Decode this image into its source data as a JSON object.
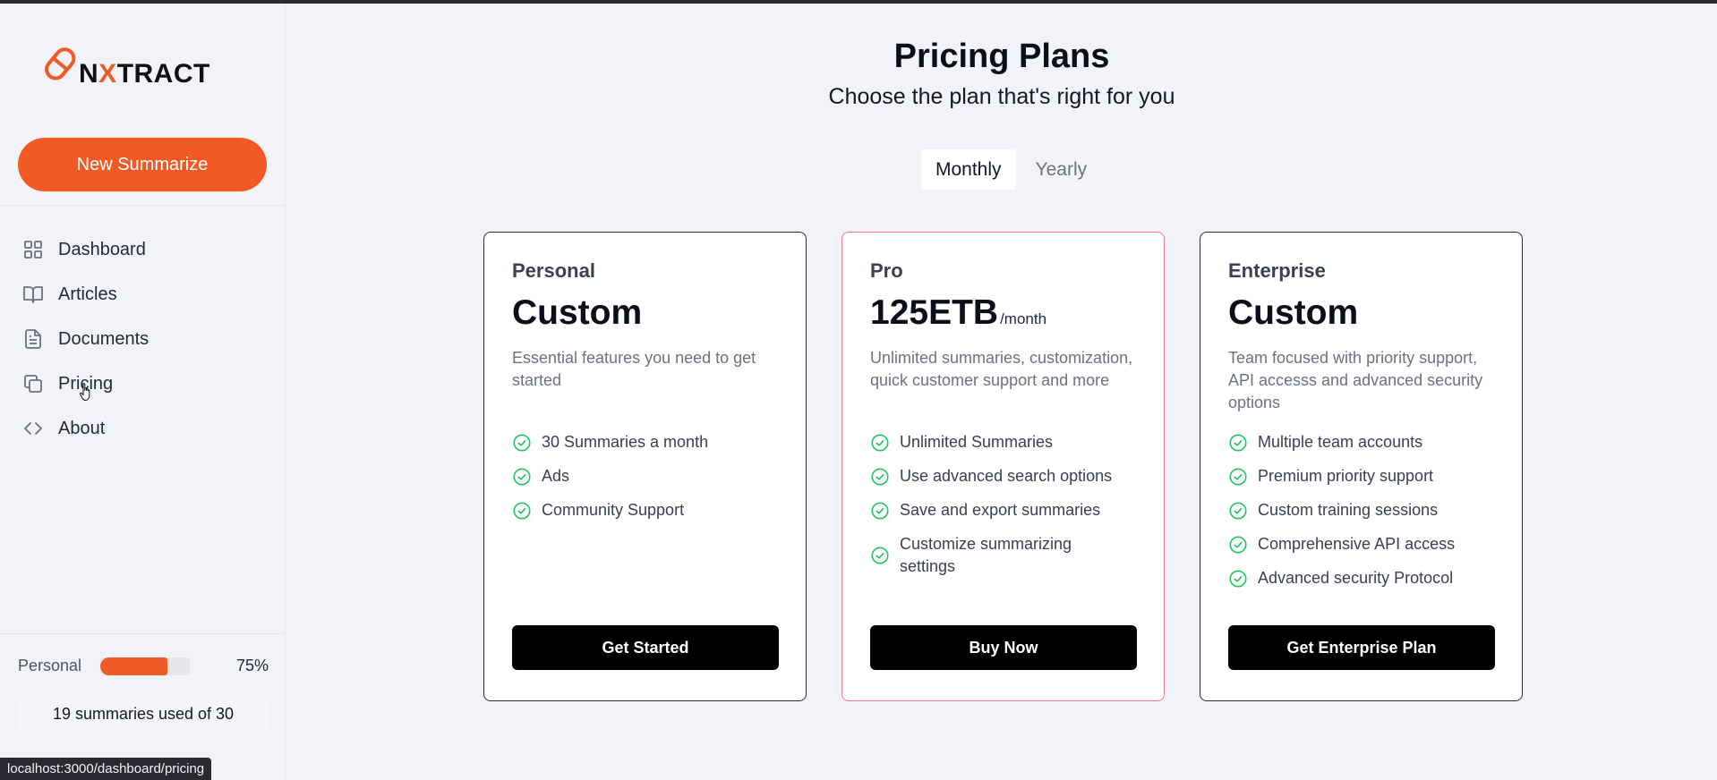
{
  "brand": {
    "logo_text_prefix": "N",
    "logo_text_x": "X",
    "logo_text_suffix": "TRACT",
    "accent": "#f15a24"
  },
  "sidebar": {
    "new_button_label": "New Summarize",
    "items": [
      {
        "label": "Dashboard",
        "icon": "grid-icon"
      },
      {
        "label": "Articles",
        "icon": "book-open-icon"
      },
      {
        "label": "Documents",
        "icon": "document-icon"
      },
      {
        "label": "Pricing",
        "icon": "copy-icon"
      },
      {
        "label": "About",
        "icon": "code-icon"
      }
    ],
    "plan": {
      "name": "Personal",
      "percent_label": "75%",
      "progress": 0.75
    },
    "usage_text": "19 summaries used of 30"
  },
  "status_url": "localhost:3000/dashboard/pricing",
  "main": {
    "title": "Pricing Plans",
    "subtitle": "Choose the plan that's right for you",
    "billing_toggle": {
      "options": [
        "Monthly",
        "Yearly"
      ],
      "selected": "Monthly"
    },
    "plans": [
      {
        "name": "Personal",
        "price": "Custom",
        "period": "",
        "description": "Essential features you need to get started",
        "features": [
          "30 Summaries a month",
          "Ads",
          "Community Support"
        ],
        "cta": "Get Started"
      },
      {
        "name": "Pro",
        "price": "125ETB",
        "period": "/month",
        "description": "Unlimited summaries, customization, quick customer support and more",
        "features": [
          "Unlimited Summaries",
          "Use advanced search options",
          "Save and export summaries",
          "Customize summarizing settings"
        ],
        "cta": "Buy Now",
        "highlight_color": "#f07a8f"
      },
      {
        "name": "Enterprise",
        "price": "Custom",
        "period": "",
        "description": "Team focused with priority support, API accesss and advanced security options",
        "features": [
          "Multiple team accounts",
          "Premium priority support",
          "Custom training sessions",
          "Comprehensive API access",
          "Advanced security Protocol"
        ],
        "cta": "Get Enterprise Plan"
      }
    ],
    "check_color": "#22c55e"
  }
}
